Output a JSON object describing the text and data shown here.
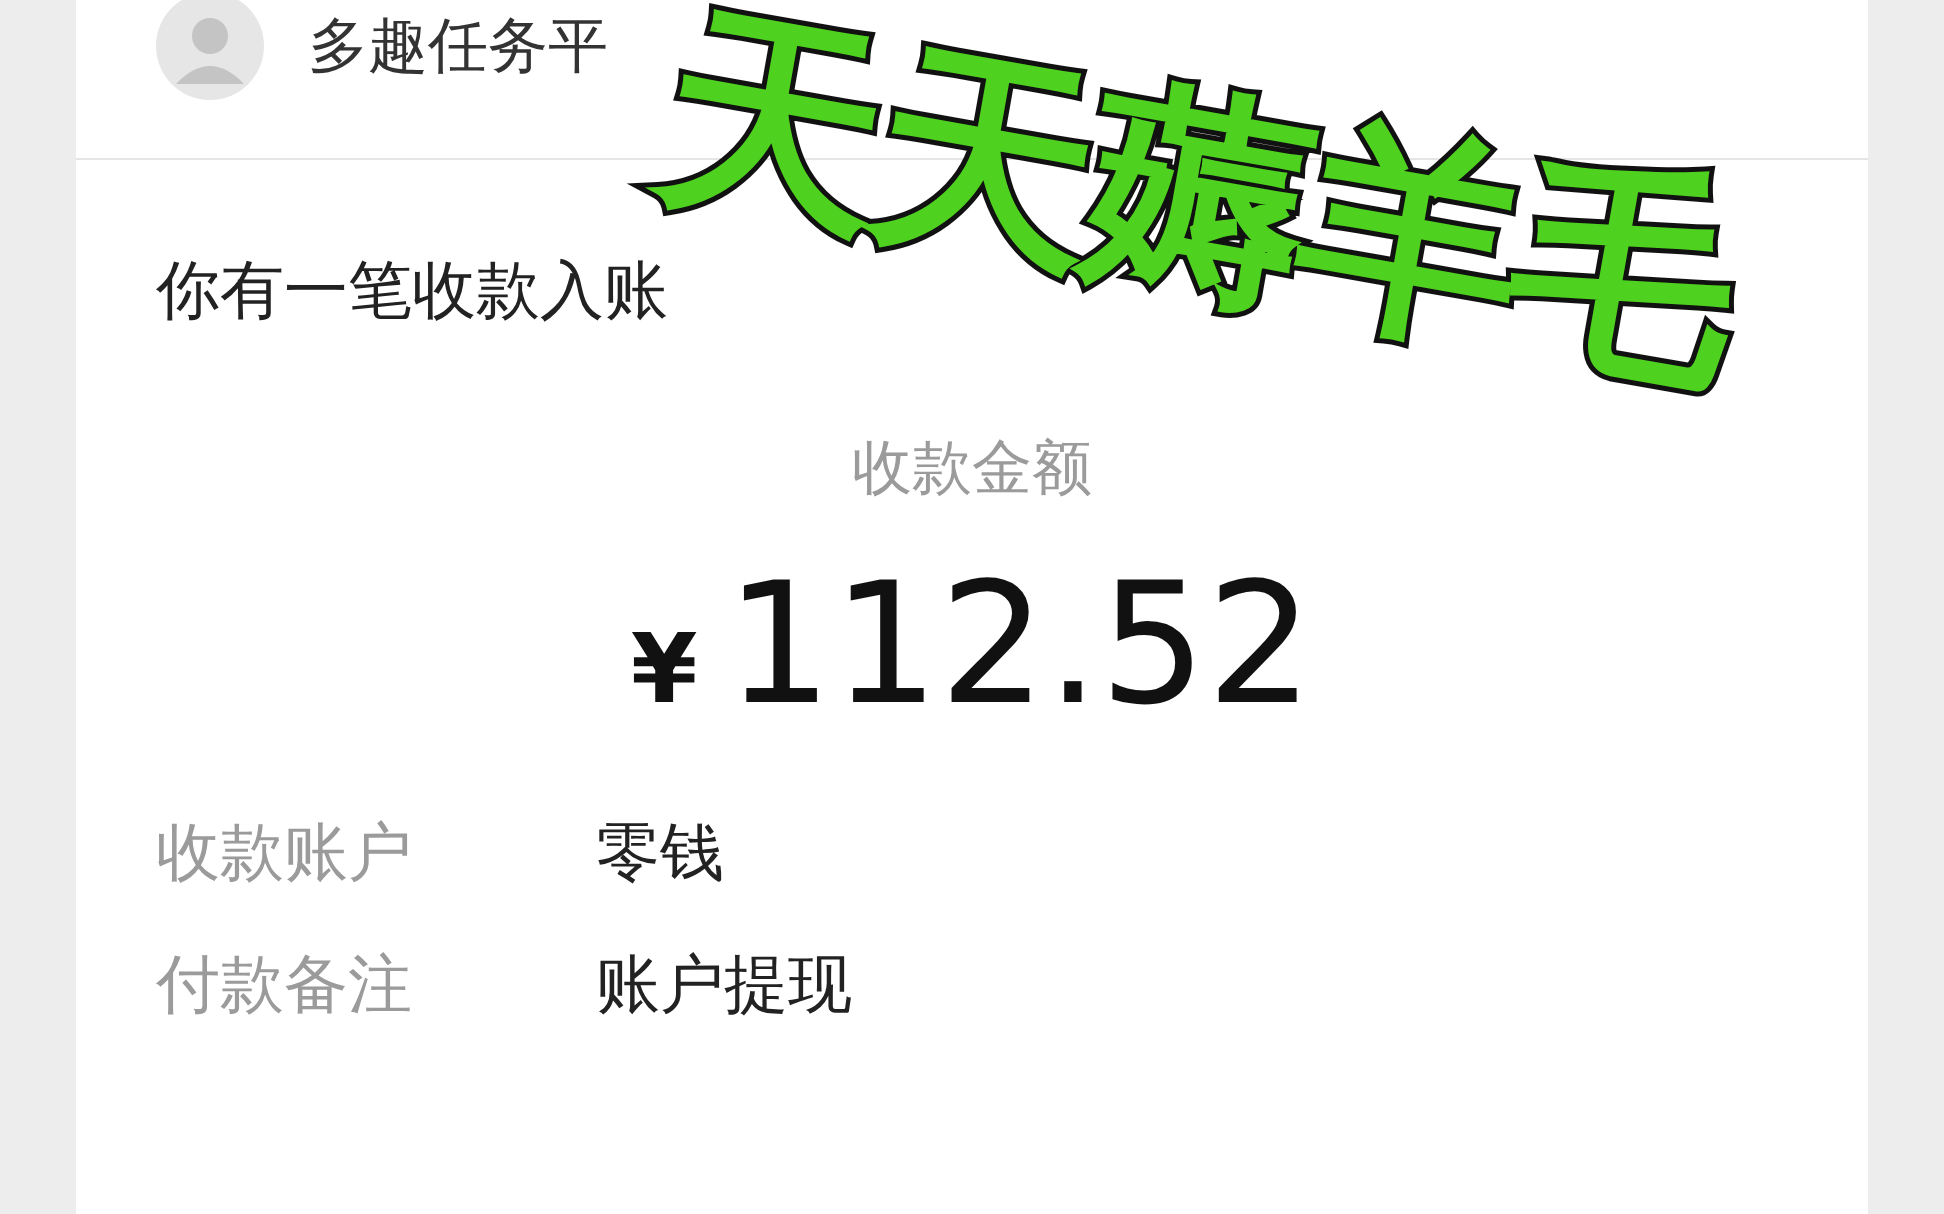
{
  "sender": {
    "name": "多趣任务平"
  },
  "title": "你有一笔收款入账",
  "amount": {
    "label": "收款金额",
    "currency": "¥",
    "value": "112.52"
  },
  "details": [
    {
      "label": "收款账户",
      "value": "零钱"
    },
    {
      "label": "付款备注",
      "value": "账户提现"
    }
  ],
  "overlay_caption": "天天薅羊毛"
}
